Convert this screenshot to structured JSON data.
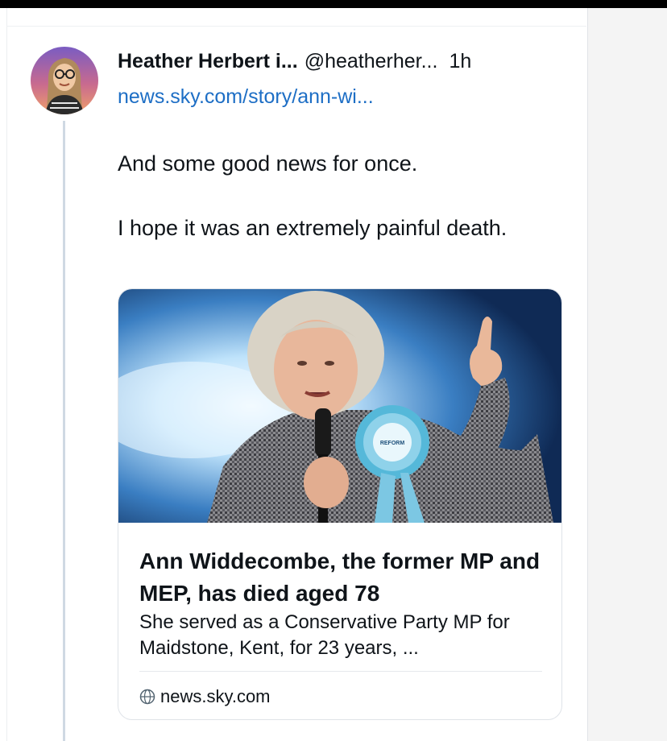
{
  "post": {
    "author_name": "Heather Herbert i...",
    "handle": "@heatherher...",
    "time": "1h",
    "link": "news.sky.com/story/ann-wi...",
    "paragraphs": [
      "And some good news for once.",
      "I hope it was an extremely painful death."
    ]
  },
  "card": {
    "title": "Ann Widdecombe, the former MP and MEP, has died aged 78",
    "description": "She served as a Conservative Party MP for Maidstone, Kent, for 23 years, ...",
    "domain": "news.sky.com",
    "rosette_text": "REFORM",
    "image_subject": "older woman with white hair speaking into a microphone, wearing a blue rosette, pointing upward"
  },
  "icons": {
    "globe": "globe-icon",
    "avatar": "profile-avatar"
  },
  "colors": {
    "link": "#1d6ec5",
    "thread_line": "#cfd9e3",
    "card_border": "#dfe3e8",
    "rosette": "#55b8d9"
  }
}
